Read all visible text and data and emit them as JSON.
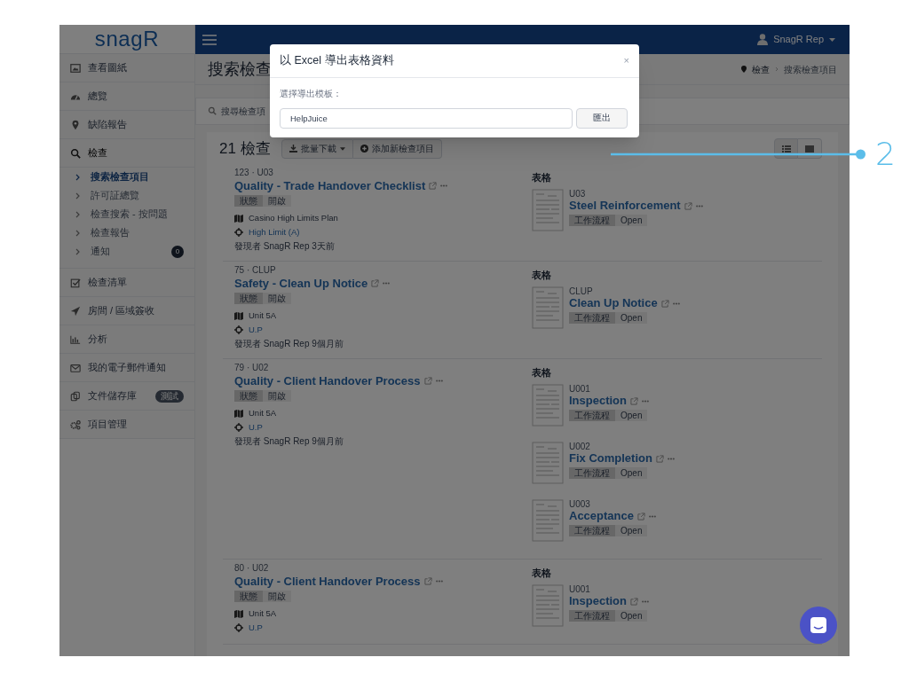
{
  "logo": "snagR",
  "top_bar": {
    "user": "SnagR Rep"
  },
  "sidebar": {
    "items": [
      {
        "label": "查看圖紙"
      },
      {
        "label": "總覽"
      },
      {
        "label": "缺陷報告"
      },
      {
        "label": "檢查",
        "expanded": true,
        "children": [
          {
            "label": "搜索檢查項目",
            "selected": true
          },
          {
            "label": "許可証總覽",
            "selected": false
          },
          {
            "label": "檢查搜索 - 按問題",
            "selected": false
          },
          {
            "label": "檢查報告",
            "selected": false
          },
          {
            "label": "通知",
            "selected": false,
            "badge": "0"
          }
        ]
      },
      {
        "label": "檢查清單"
      },
      {
        "label": "房間 / 區域簽收"
      },
      {
        "label": "分析"
      },
      {
        "label": "我的電子郵件通知"
      },
      {
        "label": "文件儲存庫",
        "badge": "測試"
      },
      {
        "label": "項目管理"
      }
    ]
  },
  "page": {
    "title": "搜索檢查",
    "breadcrumb": [
      "檢查",
      "搜索檢查項目"
    ],
    "search_placeholder": "搜尋檢查項",
    "count": "21 檢查",
    "bulk_button": "批量下載",
    "add_button": "添加新檢查項目"
  },
  "inspections": [
    {
      "code": "123 · U03",
      "title": "Quality - Trade Handover Checklist",
      "status_label": "狀態",
      "status": "開啟",
      "plan": "Casino High Limits Plan",
      "location": "High Limit (A)",
      "found_by": "發現者 SnagR Rep 3天前",
      "forms_heading": "表格",
      "forms": [
        {
          "code": "U03",
          "title": "Steel Reinforcement",
          "tag_label": "工作流程",
          "tag": "Open"
        }
      ]
    },
    {
      "code": "75 · CLUP",
      "title": "Safety - Clean Up Notice",
      "status_label": "狀態",
      "status": "開啟",
      "plan": "Unit 5A",
      "location": "U.P",
      "found_by": "發現者 SnagR Rep 9個月前",
      "forms_heading": "表格",
      "forms": [
        {
          "code": "CLUP",
          "title": "Clean Up Notice",
          "tag_label": "工作流程",
          "tag": "Open"
        }
      ]
    },
    {
      "code": "79 · U02",
      "title": "Quality - Client Handover Process",
      "status_label": "狀態",
      "status": "開啟",
      "plan": "Unit 5A",
      "location": "U.P",
      "found_by": "發現者 SnagR Rep 9個月前",
      "forms_heading": "表格",
      "forms": [
        {
          "code": "U001",
          "title": "Inspection",
          "tag_label": "工作流程",
          "tag": "Open"
        },
        {
          "code": "U002",
          "title": "Fix Completion",
          "tag_label": "工作流程",
          "tag": "Open"
        },
        {
          "code": "U003",
          "title": "Acceptance",
          "tag_label": "工作流程",
          "tag": "Open"
        }
      ]
    },
    {
      "code": "80 · U02",
      "title": "Quality - Client Handover Process",
      "status_label": "狀態",
      "status": "開啟",
      "plan": "Unit 5A",
      "location": "U.P",
      "forms_heading": "表格",
      "forms": [
        {
          "code": "U001",
          "title": "Inspection",
          "tag_label": "工作流程",
          "tag": "Open"
        }
      ]
    }
  ],
  "modal": {
    "title": "以 Excel 導出表格資料",
    "close": "×",
    "label": "選擇導出模板：",
    "value": "HelpJuice",
    "button": "匯出"
  },
  "callout": {
    "label": "2"
  }
}
